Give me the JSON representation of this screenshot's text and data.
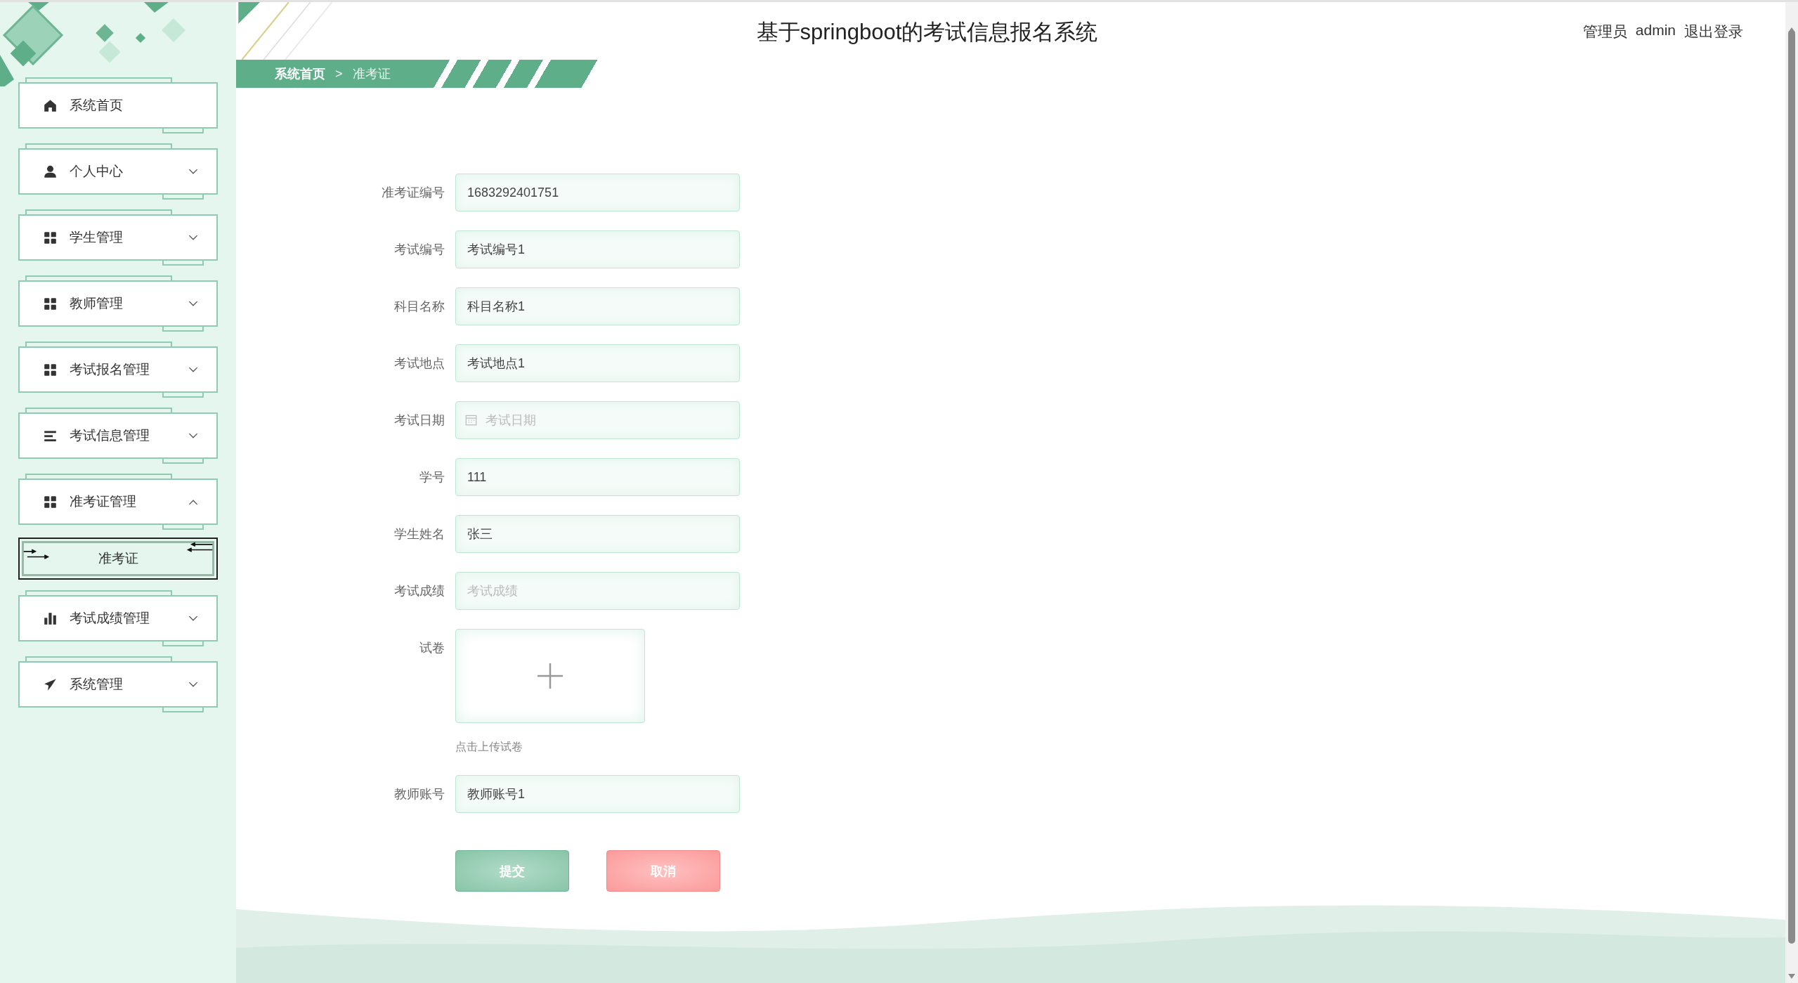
{
  "header": {
    "title": "基于springboot的考试信息报名系统",
    "user_role": "管理员",
    "user_name": "admin",
    "logout": "退出登录"
  },
  "breadcrumb": {
    "separator": ">",
    "items": [
      {
        "label": "系统首页",
        "selected": false
      },
      {
        "label": "准考证",
        "selected": true
      }
    ]
  },
  "sidebar": {
    "items": [
      {
        "label": "系统首页",
        "kind": "home"
      },
      {
        "label": "个人中心",
        "kind": "user",
        "expanded": false
      },
      {
        "label": "学生管理",
        "kind": "grid",
        "expanded": false
      },
      {
        "label": "教师管理",
        "kind": "grid",
        "expanded": false
      },
      {
        "label": "考试报名管理",
        "kind": "grid",
        "expanded": false
      },
      {
        "label": "考试信息管理",
        "kind": "list",
        "expanded": false
      },
      {
        "label": "准考证管理",
        "kind": "grid",
        "expanded": true,
        "children": [
          {
            "label": "准考证",
            "selected": true
          }
        ]
      },
      {
        "label": "考试成绩管理",
        "kind": "bars",
        "expanded": false
      },
      {
        "label": "系统管理",
        "kind": "plane",
        "expanded": false
      }
    ]
  },
  "form": {
    "fields": [
      {
        "label": "准考证编号",
        "kind": "text",
        "value": "1683292401751"
      },
      {
        "label": "考试编号",
        "kind": "text",
        "value": "考试编号1"
      },
      {
        "label": "科目名称",
        "kind": "text",
        "value": "科目名称1"
      },
      {
        "label": "考试地点",
        "kind": "text",
        "value": "考试地点1"
      },
      {
        "label": "考试日期",
        "kind": "date",
        "placeholder": "考试日期"
      },
      {
        "label": "学号",
        "kind": "text",
        "value": "111"
      },
      {
        "label": "学生姓名",
        "kind": "text",
        "value": "张三"
      },
      {
        "label": "考试成绩",
        "kind": "text",
        "placeholder": "考试成绩"
      },
      {
        "label": "试卷",
        "kind": "upload",
        "hint": "点击上传试卷"
      },
      {
        "label": "教师账号",
        "kind": "text",
        "value": "教师账号1"
      }
    ],
    "buttons": [
      {
        "label": "提交",
        "kind": "submit"
      },
      {
        "label": "取消",
        "kind": "cancel"
      }
    ]
  }
}
